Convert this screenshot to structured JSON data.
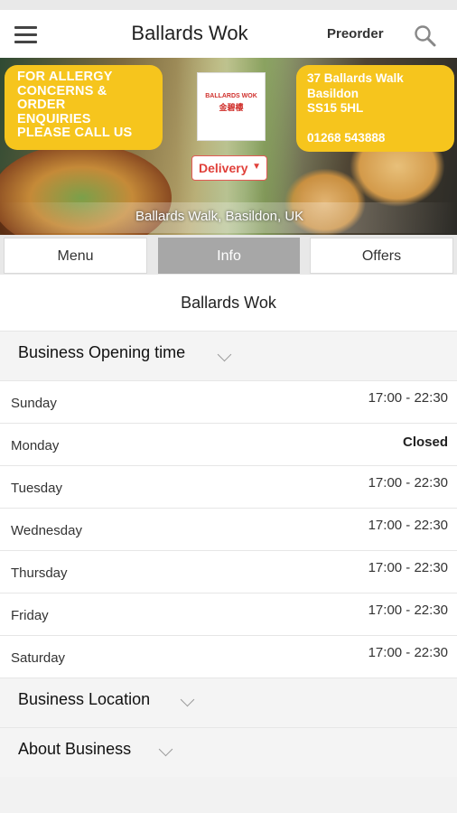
{
  "header": {
    "title": "Ballards Wok",
    "preorder_label": "Preorder"
  },
  "hero": {
    "allergy_lines": [
      "FOR ALLERGY",
      "CONCERNS &",
      "ORDER",
      "ENQUIRIES",
      "PLEASE CALL US"
    ],
    "address_lines": [
      "37 Ballards Walk",
      "Basildon",
      "SS15 5HL"
    ],
    "phone": "01268 543888",
    "logo_text": "BALLARDS WOK",
    "logo_chinese": "金碧樓",
    "delivery_label": "Delivery",
    "location": "Ballards Walk, Basildon, UK"
  },
  "tabs": [
    {
      "label": "Menu"
    },
    {
      "label": "Info"
    },
    {
      "label": "Offers"
    }
  ],
  "business_name": "Ballards Wok",
  "opening": {
    "title": "Business Opening time",
    "rows": [
      {
        "day": "Sunday",
        "time": "17:00 - 22:30"
      },
      {
        "day": "Monday",
        "time": "Closed"
      },
      {
        "day": "Tuesday",
        "time": "17:00 - 22:30"
      },
      {
        "day": "Wednesday",
        "time": "17:00 - 22:30"
      },
      {
        "day": "Thursday",
        "time": "17:00 - 22:30"
      },
      {
        "day": "Friday",
        "time": "17:00 - 22:30"
      },
      {
        "day": "Saturday",
        "time": "17:00 - 22:30"
      }
    ]
  },
  "location_section": {
    "title": "Business Location"
  },
  "about_section": {
    "title": "About Business"
  },
  "colors": {
    "badge_yellow": "#f6c51d",
    "delivery_red": "#e0403a",
    "active_tab": "#a7a7a7"
  },
  "icons": {
    "menu": "hamburger-icon",
    "search": "search-icon",
    "dropdown": "chevron-down-icon"
  }
}
